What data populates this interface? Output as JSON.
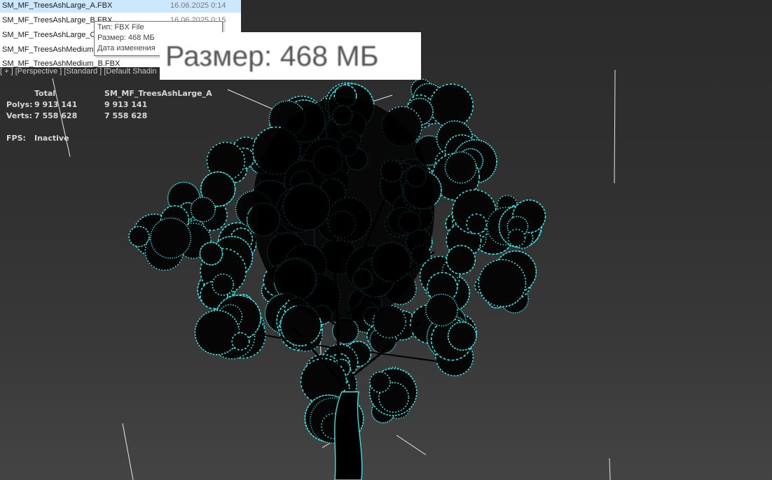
{
  "viewport": {
    "label_parts": [
      "[ + ]",
      "[Perspective ]",
      "[Standard ]",
      "[Default Shadin"
    ],
    "selection_color": "#33e6e6",
    "statistics": {
      "header": {
        "total": "Total",
        "object": "SM_MF_TreesAshLarge_A"
      },
      "polys": {
        "label": "Polys:",
        "total": "9 913 141",
        "object": "9 913 141"
      },
      "verts": {
        "label": "Verts:",
        "total": "7 558 628",
        "object": "7 558 628"
      },
      "fps": {
        "label": "FPS:",
        "value": "Inactive"
      }
    }
  },
  "explorer": {
    "files": [
      {
        "name": "SM_MF_TreesAshLarge_A.FBX",
        "date": "16.06.2025 0:14",
        "selected": true
      },
      {
        "name": "SM_MF_TreesAshLarge_B.FBX",
        "date": "16.06.2025 0:15"
      },
      {
        "name": "SM_MF_TreesAshLarge_C",
        "date": ""
      },
      {
        "name": "SM_MF_TreesAshMedium",
        "date": ""
      },
      {
        "name": "SM_MF_TreesAshMedium_B.FBX",
        "date": ""
      }
    ],
    "tooltip": {
      "type_line": "Тип: FBX File",
      "size_line": "Размер: 468 МБ",
      "modified_line": "Дата изменения"
    }
  },
  "zoom_callout": {
    "text": "Размер: 468 МБ"
  }
}
